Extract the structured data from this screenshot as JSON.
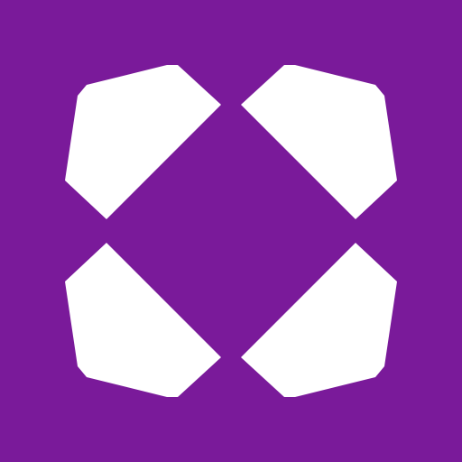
{
  "icon": {
    "semantic_name": "four-petal-x-logo-icon",
    "colors": {
      "background": "#7A1A9A",
      "foreground": "#FFFFFF"
    }
  }
}
